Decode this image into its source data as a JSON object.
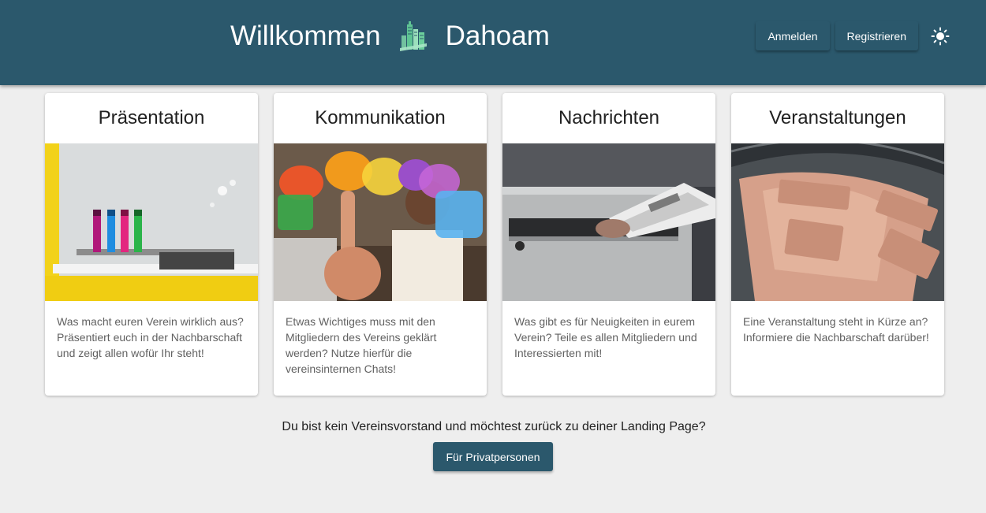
{
  "header": {
    "title_left": "Willkommen",
    "title_right": "Dahoam",
    "logo_icon": "city-buildings-logo-icon",
    "login_label": "Anmelden",
    "register_label": "Registrieren",
    "theme_icon": "sun-icon"
  },
  "colors": {
    "primary": "#2b586c",
    "background": "#eeeeee",
    "card": "#ffffff"
  },
  "cards": [
    {
      "title": "Präsentation",
      "text": "Was macht euren Verein wirklich aus? Präsentiert euch in der Nachbarschaft und zeigt allen wofür Ihr steht!"
    },
    {
      "title": "Kommunikation",
      "text": "Etwas Wichtiges muss mit den Mitgliedern des Vereins geklärt werden? Nutze hierfür die vereinsinternen Chats!"
    },
    {
      "title": "Nachrichten",
      "text": "Was gibt es für Neuigkeiten in eurem Verein? Teile es allen Mitgliedern und Interessierten mit!"
    },
    {
      "title": "Veranstaltungen",
      "text": "Eine Veranstaltung steht in Kürze an? Informiere die Nachbarschaft darüber!"
    }
  ],
  "footer": {
    "question": "Du bist kein Vereinsvorstand und möchtest zurück zu deiner Landing Page?",
    "private_button_label": "Für Privatpersonen"
  }
}
